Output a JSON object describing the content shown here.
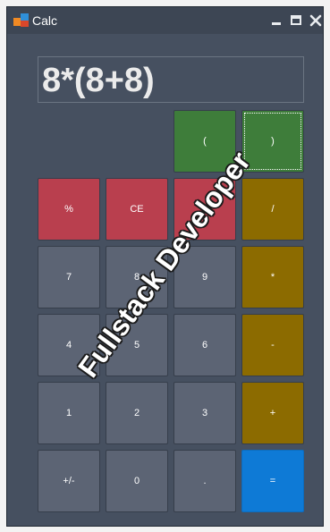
{
  "window": {
    "title": "Calc",
    "icon": "calc-app-icon"
  },
  "title_controls": {
    "minimize_icon": "minimize-icon",
    "maximize_icon": "maximize-icon",
    "close_icon": "close-icon"
  },
  "display": {
    "expression": "8*(8+8)"
  },
  "buttons": {
    "open_paren": "(",
    "close_paren": ")",
    "percent": "%",
    "clear_entry": "CE",
    "clear": "C",
    "divide": "/",
    "seven": "7",
    "eight": "8",
    "nine": "9",
    "multiply": "*",
    "four": "4",
    "five": "5",
    "six": "6",
    "subtract": "-",
    "one": "1",
    "two": "2",
    "three": "3",
    "add": "+",
    "plus_minus": "+/-",
    "zero": "0",
    "decimal": ".",
    "equals": "="
  },
  "colors": {
    "background": "#465060",
    "number": "#5c6474",
    "red": "#b93f4e",
    "green": "#3e7d3a",
    "olive": "#8c6b00",
    "blue": "#0e7ad6"
  },
  "watermark": {
    "text": "Fullstack Developer"
  }
}
